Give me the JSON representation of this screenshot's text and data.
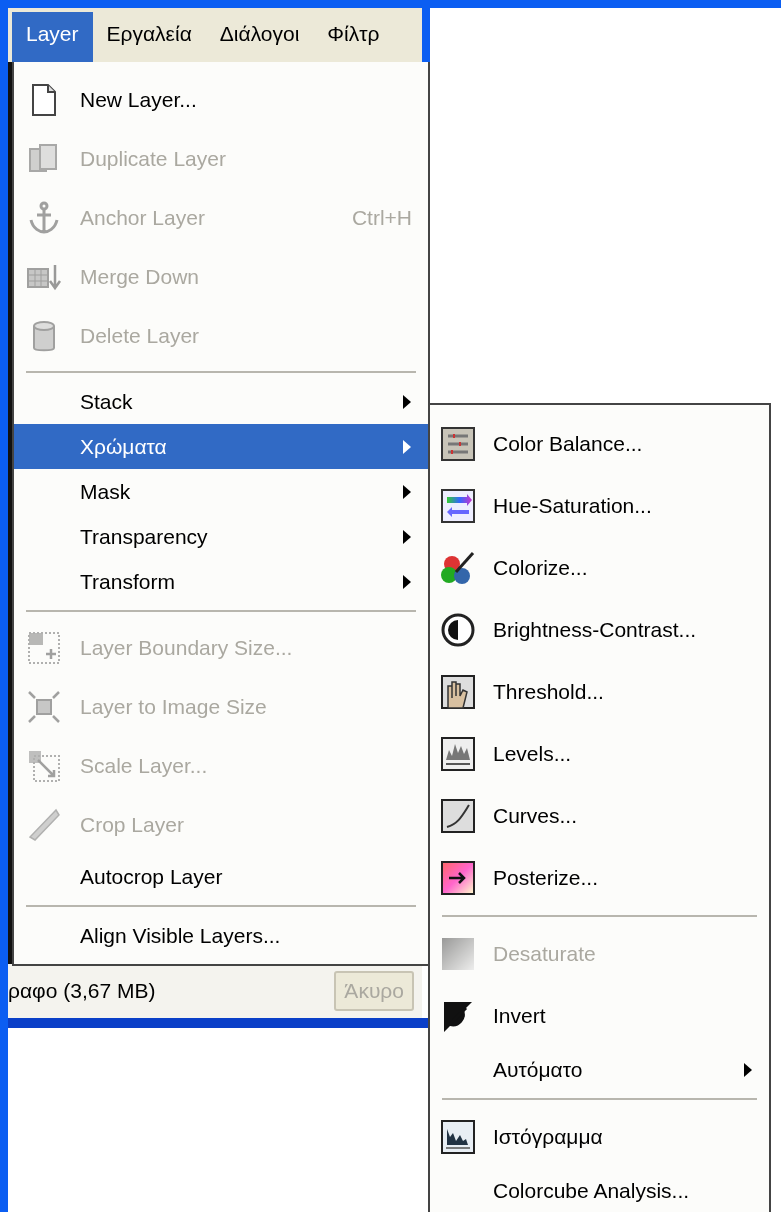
{
  "menubar": [
    {
      "label": "Layer",
      "selected": true
    },
    {
      "label": "Εργαλεία",
      "selected": false
    },
    {
      "label": "Διάλογοι",
      "selected": false
    },
    {
      "label": "Φίλτρ",
      "selected": false
    }
  ],
  "layer_menu": {
    "items": [
      {
        "kind": "icon",
        "label": "New Layer...",
        "disabled": false,
        "selected": false,
        "submenu": false
      },
      {
        "kind": "icon",
        "label": "Duplicate Layer",
        "disabled": true,
        "selected": false,
        "submenu": false
      },
      {
        "kind": "icon",
        "label": "Anchor Layer",
        "shortcut": "Ctrl+H",
        "disabled": true,
        "selected": false,
        "submenu": false
      },
      {
        "kind": "icon",
        "label": "Merge Down",
        "disabled": true,
        "selected": false,
        "submenu": false
      },
      {
        "kind": "icon",
        "label": "Delete Layer",
        "disabled": true,
        "selected": false,
        "submenu": false
      },
      {
        "kind": "separator"
      },
      {
        "kind": "plain",
        "label": "Stack",
        "disabled": false,
        "selected": false,
        "submenu": true
      },
      {
        "kind": "plain",
        "label": "Χρώματα",
        "disabled": false,
        "selected": true,
        "submenu": true
      },
      {
        "kind": "plain",
        "label": "Mask",
        "disabled": false,
        "selected": false,
        "submenu": true
      },
      {
        "kind": "plain",
        "label": "Transparency",
        "disabled": false,
        "selected": false,
        "submenu": true
      },
      {
        "kind": "plain",
        "label": "Transform",
        "disabled": false,
        "selected": false,
        "submenu": true
      },
      {
        "kind": "separator"
      },
      {
        "kind": "icon",
        "label": "Layer Boundary Size...",
        "disabled": true,
        "selected": false,
        "submenu": false
      },
      {
        "kind": "icon",
        "label": "Layer to Image Size",
        "disabled": true,
        "selected": false,
        "submenu": false
      },
      {
        "kind": "icon",
        "label": "Scale Layer...",
        "disabled": true,
        "selected": false,
        "submenu": false
      },
      {
        "kind": "icon",
        "label": "Crop Layer",
        "disabled": true,
        "selected": false,
        "submenu": false
      },
      {
        "kind": "plain",
        "label": "Autocrop Layer",
        "disabled": false,
        "selected": false,
        "submenu": false
      },
      {
        "kind": "separator"
      },
      {
        "kind": "plain",
        "label": "Align Visible Layers...",
        "disabled": false,
        "selected": false,
        "submenu": false
      }
    ]
  },
  "colors_submenu": {
    "items": [
      {
        "kind": "icon",
        "label": "Color Balance...",
        "disabled": false,
        "selected": false,
        "submenu": false
      },
      {
        "kind": "icon",
        "label": "Hue-Saturation...",
        "disabled": false,
        "selected": false,
        "submenu": false
      },
      {
        "kind": "icon",
        "label": "Colorize...",
        "disabled": false,
        "selected": false,
        "submenu": false
      },
      {
        "kind": "icon",
        "label": "Brightness-Contrast...",
        "disabled": false,
        "selected": false,
        "submenu": false
      },
      {
        "kind": "icon",
        "label": "Threshold...",
        "disabled": false,
        "selected": false,
        "submenu": false
      },
      {
        "kind": "icon",
        "label": "Levels...",
        "disabled": false,
        "selected": false,
        "submenu": false
      },
      {
        "kind": "icon",
        "label": "Curves...",
        "disabled": false,
        "selected": false,
        "submenu": false
      },
      {
        "kind": "icon",
        "label": "Posterize...",
        "disabled": false,
        "selected": false,
        "submenu": false
      },
      {
        "kind": "separator"
      },
      {
        "kind": "icon",
        "label": "Desaturate",
        "disabled": true,
        "selected": false,
        "submenu": false
      },
      {
        "kind": "icon",
        "label": "Invert",
        "disabled": false,
        "selected": false,
        "submenu": false
      },
      {
        "kind": "plain",
        "label": "Αυτόματο",
        "disabled": false,
        "selected": false,
        "submenu": true
      },
      {
        "kind": "separator"
      },
      {
        "kind": "icon",
        "label": "Ιστόγραμμα",
        "disabled": false,
        "selected": false,
        "submenu": false
      },
      {
        "kind": "plain",
        "label": "Colorcube Analysis...",
        "disabled": false,
        "selected": false,
        "submenu": false
      }
    ]
  },
  "background_dialog": {
    "status_text": "ραφο (3,67 MB)",
    "cancel_button": {
      "label": "Άκυρο",
      "disabled": true
    }
  }
}
